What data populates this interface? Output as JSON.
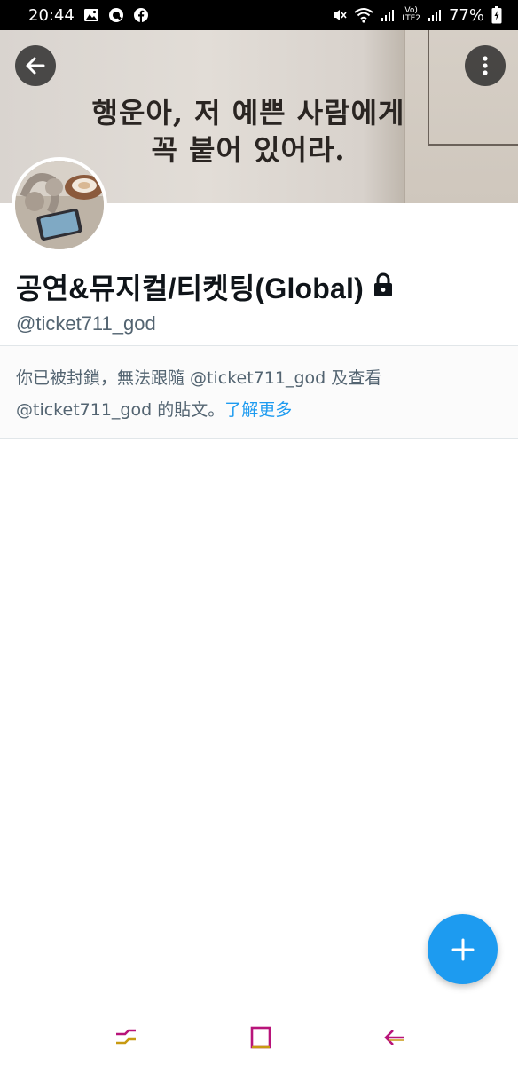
{
  "status_bar": {
    "time": "20:44",
    "battery": "77%",
    "network_label_top": "Vo)",
    "network_label_bottom": "LTE2",
    "icons": [
      "image-icon",
      "q-app-icon",
      "facebook-icon",
      "mute-icon",
      "wifi-icon",
      "signal-icon",
      "battery-icon"
    ]
  },
  "banner": {
    "line1": "행운아, 저 예쁜 사람에게",
    "line2": "꼭 붙어 있어라."
  },
  "profile": {
    "name": "공연&뮤지컬/티켓팅(Global)",
    "handle": "@ticket711_god"
  },
  "notice": {
    "text": "你已被封鎖，無法跟隨 @ticket711_god 及查看 @ticket711_god 的貼文。",
    "learn_more": "了解更多"
  },
  "colors": {
    "accent": "#1d9bf0",
    "secondary_text": "#536471",
    "primary_text": "#0f1419",
    "nav_icon": "#c2185b"
  }
}
